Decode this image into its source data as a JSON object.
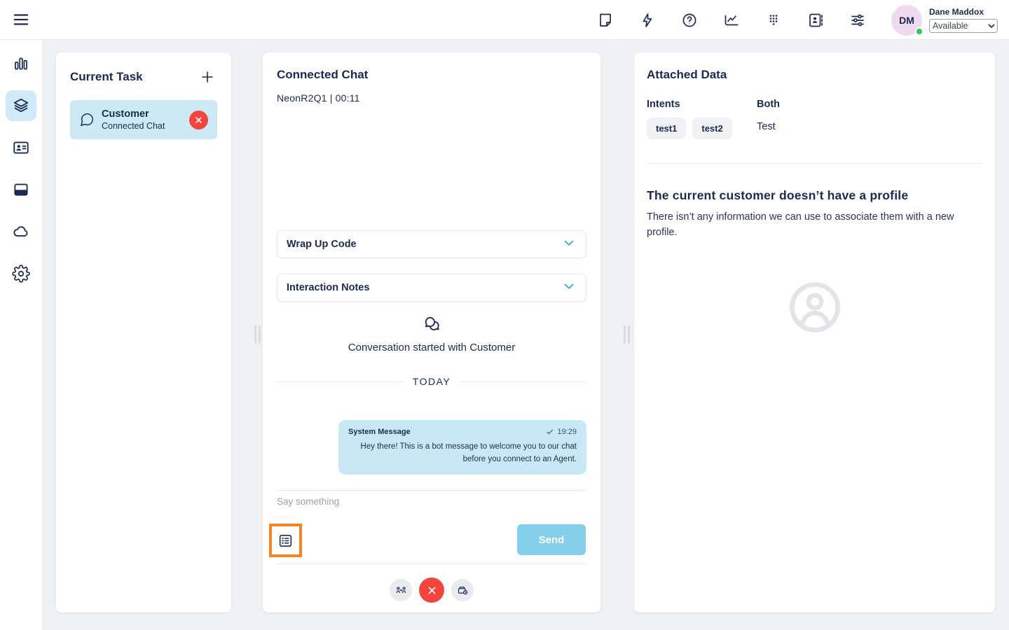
{
  "topbar": {
    "icons": [
      "note-icon",
      "quick-launch-icon",
      "help-icon",
      "reports-icon",
      "dialpad-icon",
      "directory-icon",
      "settings-sliders-icon"
    ],
    "user": {
      "initials": "DM",
      "name": "Dane Maddox",
      "status": "Available"
    }
  },
  "sidebar": {
    "icons": [
      "menu-icon",
      "metrics-icon",
      "interactions-icon",
      "customer-card-icon",
      "apps-window-icon",
      "cloud-icon",
      "gear-icon"
    ],
    "active_item": "interactions"
  },
  "current_task": {
    "title": "Current Task",
    "task": {
      "name": "Customer",
      "subtitle": "Connected Chat"
    }
  },
  "chat": {
    "title": "Connected Chat",
    "subtitle": "NeonR2Q1 | 00:11",
    "wrap_up_label": "Wrap Up Code",
    "notes_label": "Interaction Notes",
    "started_text": "Conversation started with Customer",
    "day_divider": "TODAY",
    "message": {
      "sender": "System Message",
      "time": "19:29",
      "text": "Hey there! This is a bot message to welcome you to our chat before you connect to an Agent."
    },
    "input_placeholder": "Say something",
    "send_label": "Send"
  },
  "attached_data": {
    "title": "Attached Data",
    "intents_label": "Intents",
    "intents": [
      "test1",
      "test2"
    ],
    "both_label": "Both",
    "both_value": "Test",
    "no_profile_title": "The current customer doesn’t have a profile",
    "no_profile_text": "There isn’t any information we can use to associate them with a new profile."
  },
  "colors": {
    "navy": "#1b2b55",
    "active_tile": "#cfeaf8",
    "task_item_bg": "#cde9f6",
    "bubble_bg": "#c8e8f6",
    "send_bg": "#84d0ec",
    "end_red": "#f2453d",
    "highlight_orange": "#f5831f",
    "avatar_bg": "#eed9ee",
    "status_green": "#2dc84d",
    "chevron_blue": "#3aa7dd",
    "page_bg": "#eef0f3"
  }
}
